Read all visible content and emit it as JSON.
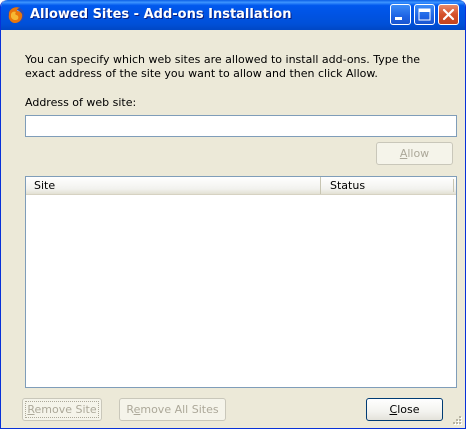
{
  "window": {
    "title": "Allowed Sites - Add-ons Installation"
  },
  "content": {
    "description": "You can specify which web sites are allowed to install add-ons. Type the exact address of the site you want to allow and then click Allow.",
    "address_label": "Address of web site:",
    "address_value": "",
    "allow_button": {
      "accel": "A",
      "rest": "llow"
    },
    "list": {
      "columns": [
        "Site",
        "Status"
      ],
      "rows": []
    },
    "remove_site_button": {
      "accel": "R",
      "rest": "emove Site"
    },
    "remove_all_button": {
      "pre": "R",
      "accel": "e",
      "rest": "move All Sites"
    },
    "close_button": {
      "accel": "C",
      "rest": "lose"
    }
  },
  "icons": {
    "app": "firefox-icon",
    "minimize": "minimize-icon",
    "maximize": "maximize-icon",
    "close": "close-icon"
  }
}
